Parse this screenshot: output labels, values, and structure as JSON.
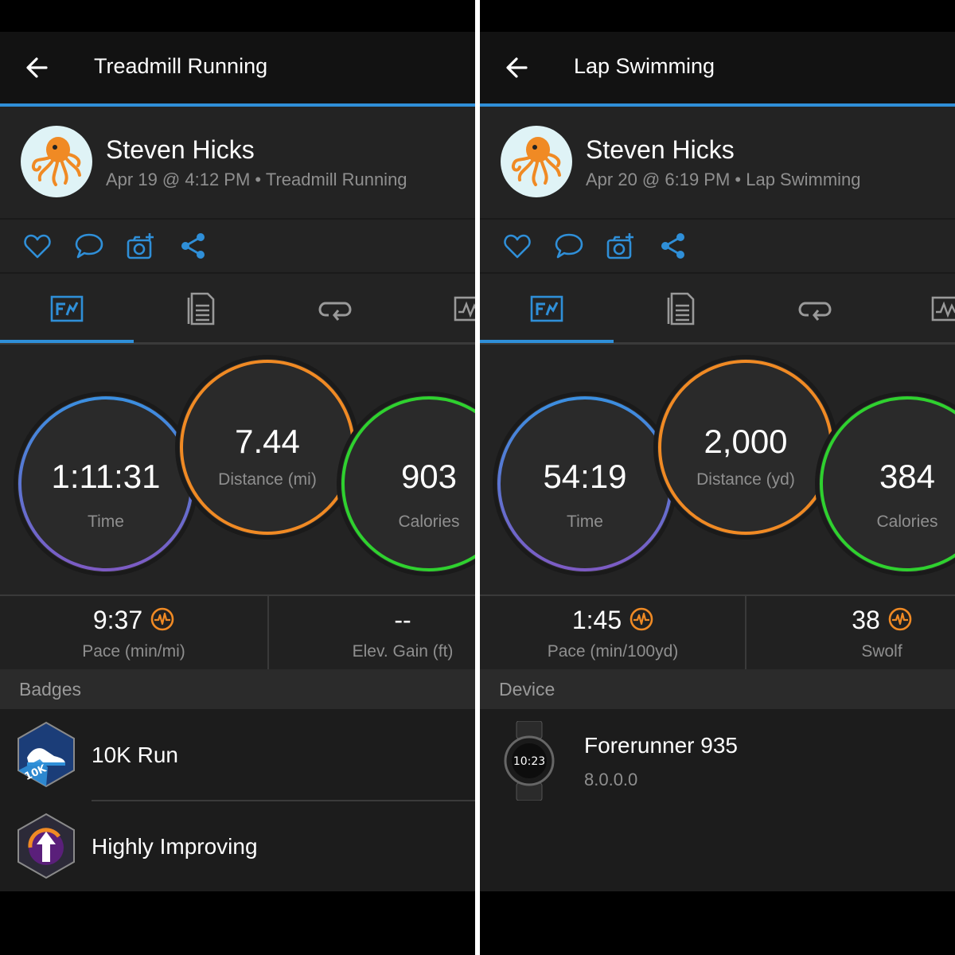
{
  "left": {
    "title": "Treadmill Running",
    "user_name": "Steven Hicks",
    "meta": "Apr 19 @ 4:12 PM • Treadmill Running",
    "circles": {
      "time": {
        "value": "1:11:31",
        "label": "Time"
      },
      "distance": {
        "value": "7.44",
        "label": "Distance (mi)"
      },
      "calories": {
        "value": "903",
        "label": "Calories"
      }
    },
    "stats": [
      {
        "value": "9:37",
        "label": "Pace (min/mi)"
      },
      {
        "value": "--",
        "label": "Elev. Gain (ft)"
      }
    ],
    "section_title": "Badges",
    "badges": [
      {
        "label": "10K Run",
        "badge_text": "10K"
      },
      {
        "label": "Highly Improving"
      }
    ]
  },
  "right": {
    "title": "Lap Swimming",
    "user_name": "Steven Hicks",
    "meta": "Apr 20 @ 6:19 PM • Lap Swimming",
    "circles": {
      "time": {
        "value": "54:19",
        "label": "Time"
      },
      "distance": {
        "value": "2,000",
        "label": "Distance (yd)"
      },
      "calories": {
        "value": "384",
        "label": "Calories"
      }
    },
    "stats": [
      {
        "value": "1:45",
        "label": "Pace (min/100yd)"
      },
      {
        "value": "38",
        "label": "Swolf"
      }
    ],
    "section_title": "Device",
    "device": {
      "name": "Forerunner 935",
      "version": "8.0.0.0",
      "watch_face_time": "10:23"
    }
  },
  "icons": {
    "back": "arrow-left-icon",
    "like": "heart-icon",
    "comment": "speech-bubble-icon",
    "photo": "camera-add-icon",
    "share": "share-icon",
    "tab_overview": "overview-chart-icon",
    "tab_details": "document-list-icon",
    "tab_laps": "laps-loop-icon",
    "tab_charts": "chart-icon",
    "pulse": "pulse-icon"
  },
  "colors": {
    "accent_blue": "#2f8fd8",
    "time_ring_top": "#3b8fe0",
    "time_ring_bottom": "#7d5bc4",
    "distance_ring": "#f08a24",
    "calories_ring": "#2fd12f",
    "pulse_icon": "#f08a24"
  }
}
